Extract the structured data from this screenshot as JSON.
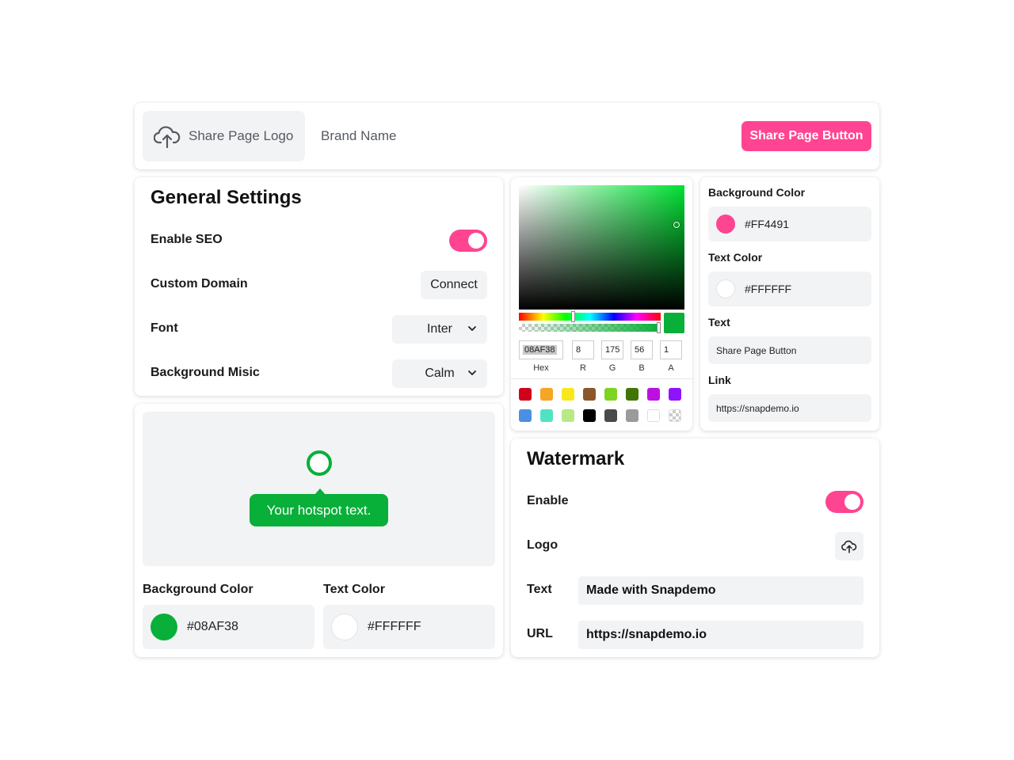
{
  "topbar": {
    "logo_label": "Share Page Logo",
    "logo_icon": "cloud-upload-icon",
    "brand_name": "Brand Name",
    "button_label": "Share Page Button",
    "button_color": "#FF4491"
  },
  "general": {
    "title": "General Settings",
    "seo_label": "Enable SEO",
    "seo_enabled": true,
    "domain_label": "Custom Domain",
    "domain_button": "Connect",
    "font_label": "Font",
    "font_value": "Inter",
    "music_label": "Background Misic",
    "music_value": "Calm"
  },
  "hotspot": {
    "tooltip_text": "Your hotspot text.",
    "bg_label": "Background Color",
    "bg_value": "#08AF38",
    "text_label": "Text Color",
    "text_value": "#FFFFFF"
  },
  "picker": {
    "hex": "08AF38",
    "r": "8",
    "g": "175",
    "b": "56",
    "a": "1",
    "labels": {
      "hex": "Hex",
      "r": "R",
      "g": "G",
      "b": "B",
      "a": "A"
    },
    "presets": [
      "#D0021B",
      "#F5A623",
      "#F8E71C",
      "#8B572A",
      "#7ED321",
      "#417505",
      "#BD10E0",
      "#9013FE",
      "#4A90E2",
      "#50E3C2",
      "#B8E986",
      "#000000",
      "#4A4A4A",
      "#9B9B9B",
      "#FFFFFF",
      "transparent"
    ]
  },
  "button_settings": {
    "bg_label": "Background Color",
    "bg_value": "#FF4491",
    "text_color_label": "Text Color",
    "text_color_value": "#FFFFFF",
    "text_label": "Text",
    "text_value": "Share Page Button",
    "link_label": "Link",
    "link_value": "https://snapdemo.io"
  },
  "watermark": {
    "title": "Watermark",
    "enable_label": "Enable",
    "enabled": true,
    "logo_label": "Logo",
    "text_label": "Text",
    "text_value": "Made with Snapdemo",
    "url_label": "URL",
    "url_value": "https://snapdemo.io"
  }
}
